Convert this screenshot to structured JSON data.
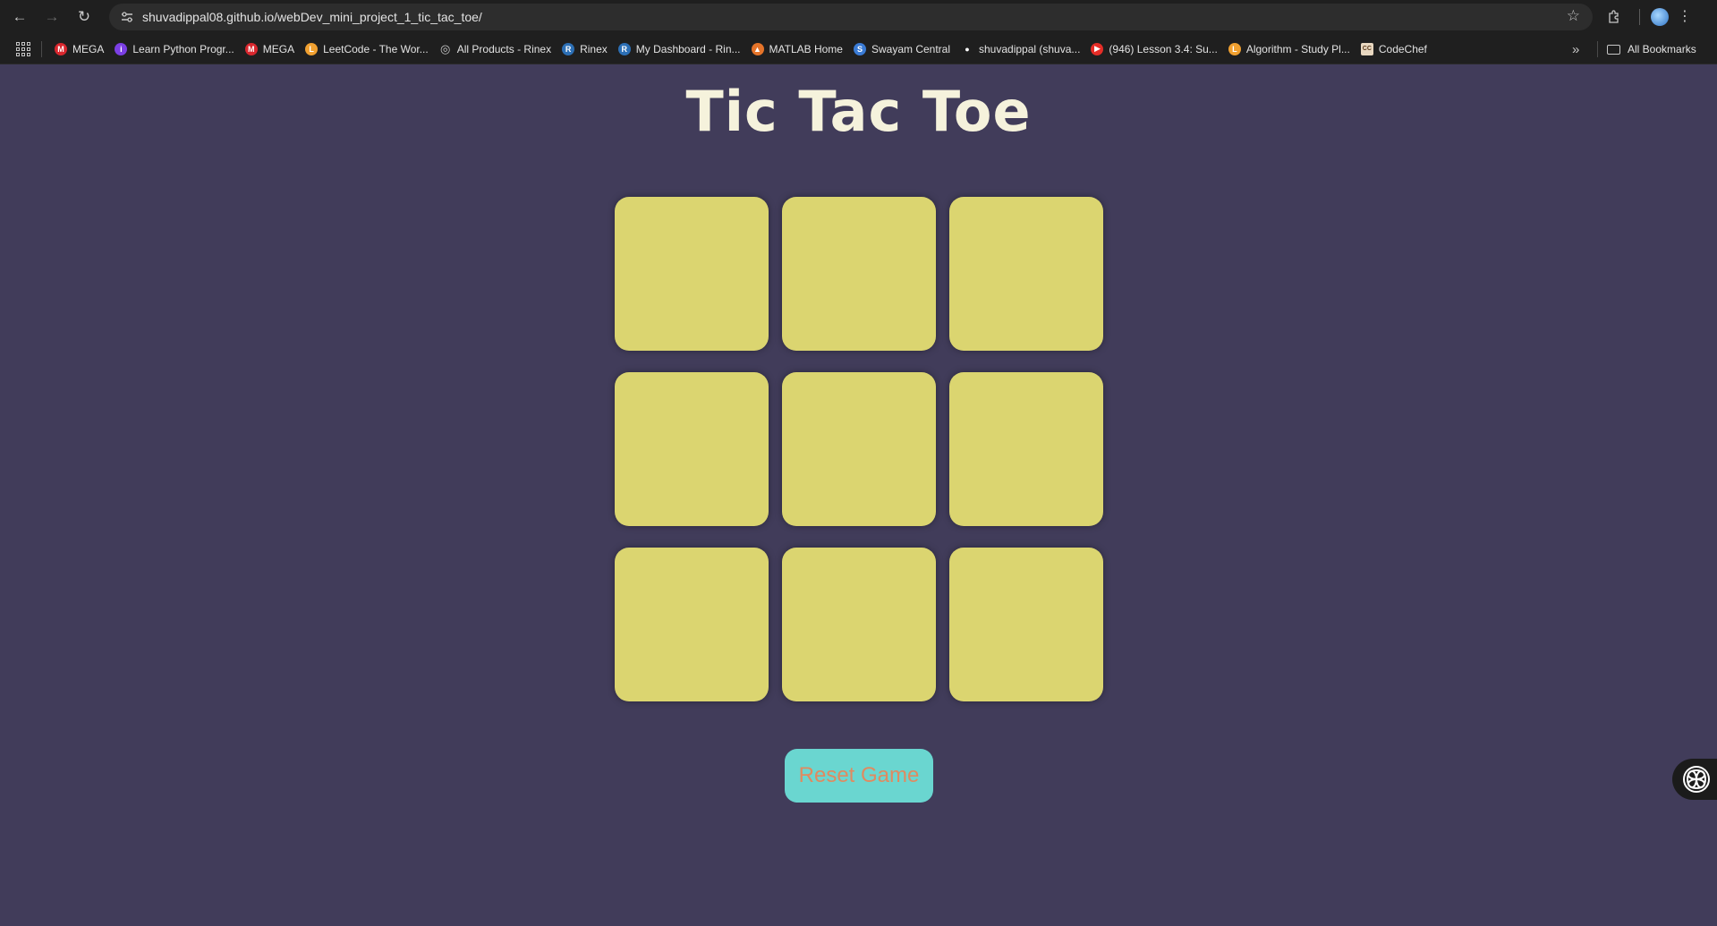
{
  "browser": {
    "url_host": "shuvadippal08.github.io",
    "url_path": "/webDev_mini_project_1_tic_tac_toe/",
    "bookmarks": [
      {
        "label": "MEGA",
        "icon": "mega-icon",
        "color": "#d9272e",
        "glyph": "M"
      },
      {
        "label": "Learn Python Progr...",
        "icon": "python-course-icon",
        "color": "#7b3fe4",
        "glyph": "i"
      },
      {
        "label": "MEGA",
        "icon": "mega-icon",
        "color": "#d9272e",
        "glyph": "M"
      },
      {
        "label": "LeetCode - The Wor...",
        "icon": "leetcode-icon",
        "color": "#f0a030",
        "glyph": "L"
      },
      {
        "label": "All Products - Rinex",
        "icon": "globe-icon",
        "color": "#8a8a8a",
        "glyph": "◎"
      },
      {
        "label": "Rinex",
        "icon": "rinex-icon",
        "color": "#2c6fb5",
        "glyph": "R"
      },
      {
        "label": "My Dashboard - Rin...",
        "icon": "rinex-icon",
        "color": "#2c6fb5",
        "glyph": "R"
      },
      {
        "label": "MATLAB Home",
        "icon": "matlab-icon",
        "color": "#e5742a",
        "glyph": "▲"
      },
      {
        "label": "Swayam Central",
        "icon": "swayam-icon",
        "color": "#3a7bd5",
        "glyph": "S"
      },
      {
        "label": "shuvadippal (shuva...",
        "icon": "github-icon",
        "color": "#ffffff",
        "glyph": "●"
      },
      {
        "label": "(946) Lesson 3.4: Su...",
        "icon": "youtube-icon",
        "color": "#e52d27",
        "glyph": "▶"
      },
      {
        "label": "Algorithm - Study Pl...",
        "icon": "leetcode-icon",
        "color": "#f0a030",
        "glyph": "L"
      },
      {
        "label": "CodeChef",
        "icon": "codechef-icon",
        "color": "#8b5a2b",
        "glyph": "CC"
      }
    ],
    "all_bookmarks_label": "All Bookmarks"
  },
  "game": {
    "title": "Tic Tac Toe",
    "cells": [
      "",
      "",
      "",
      "",
      "",
      "",
      "",
      "",
      ""
    ],
    "reset_label": "Reset Game"
  },
  "colors": {
    "background": "#413c5a",
    "cell": "#dbd570",
    "reset_button": "#6ad6d0",
    "reset_text": "#e08a60",
    "title": "#f5f2dc"
  }
}
